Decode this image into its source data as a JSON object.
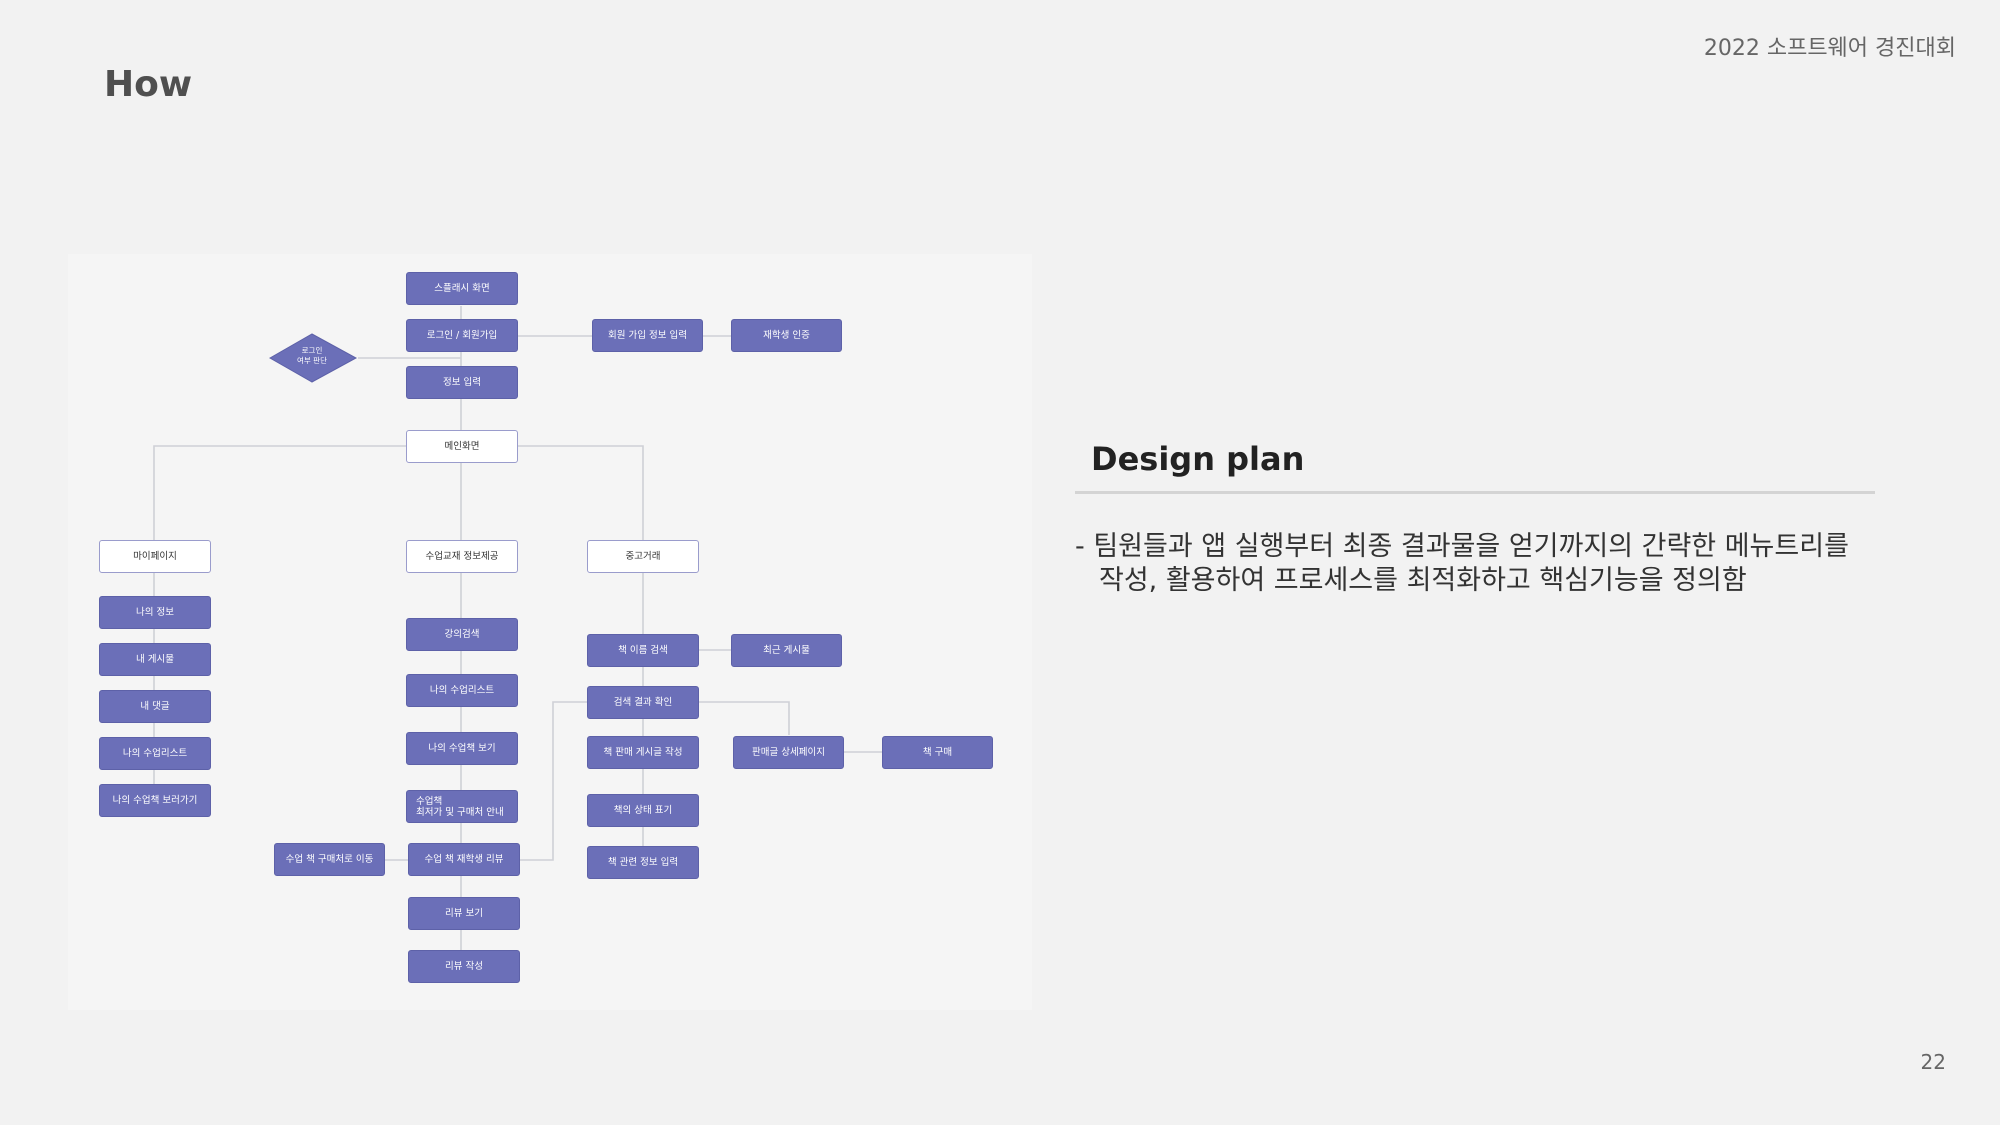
{
  "header": {
    "title": "How",
    "event": "2022 소프트웨어 경진대회"
  },
  "page_number": "22",
  "diagram": {
    "splash": "스플래시 화면",
    "login": "로그인 / 회원가입",
    "signup_info": "회원 가입 정보 입력",
    "student_verify": "재학생 인증",
    "login_check_line1": "로그인",
    "login_check_line2": "여부 판단",
    "info_input": "정보 입력",
    "main": "메인화면",
    "mypage": "마이페이지",
    "class_info": "수업교재 정보제공",
    "used_trade": "중고거래",
    "my_info": "나의 정보",
    "my_posts": "내 게시물",
    "my_comments": "내 댓글",
    "my_class_list_mypage": "나의 수업리스트",
    "my_class_books_go": "나의 수업책 보러가기",
    "lecture_search": "강의검색",
    "my_class_list": "나의 수업리스트",
    "my_class_books_view": "나의 수업책 보기",
    "lowest_price_line1": "수업책",
    "lowest_price_line2": "최저가 및 구매처 안내",
    "move_to_store": "수업 책 구매처로 이동",
    "class_book_review": "수업 책 재학생 리뷰",
    "review_view": "리뷰 보기",
    "review_write": "리뷰 작성",
    "book_search": "책 이름 검색",
    "recent_posts": "최근 게시물",
    "search_result": "검색 결과 확인",
    "sale_post_write": "책 판매 게시글 작성",
    "sale_detail_page": "판매글 상세페이지",
    "book_purchase": "책 구매",
    "book_condition": "책의 상태 표기",
    "book_info_input": "책 관련 정보 입력"
  },
  "design_plan": {
    "heading": "Design plan",
    "line1": "- 팀원들과 앱 실행부터 최종 결과물을 얻기까지의 간략한 메뉴트리를",
    "line2": "작성, 활용하여 프로세스를 최적화하고 핵심기능을 정의함"
  },
  "colors": {
    "node_fill": "#6b6fb8",
    "node_border": "#9a9ccc",
    "connector": "#cfd0d6"
  }
}
